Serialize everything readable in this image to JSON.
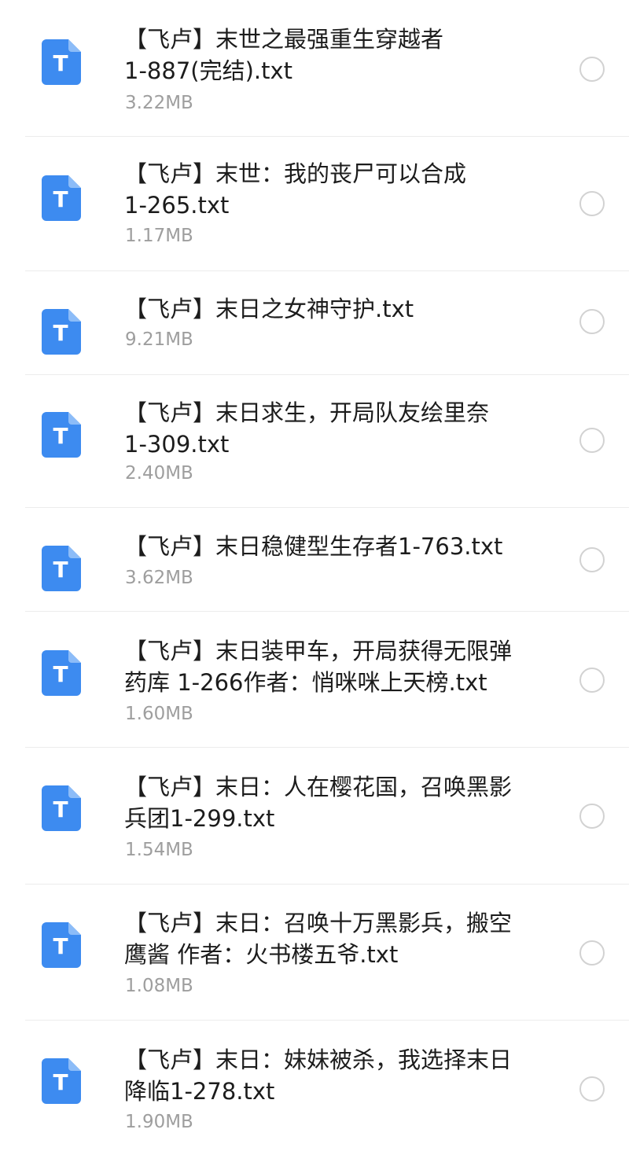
{
  "icon": {
    "name": "text-file-icon",
    "glyph": "T",
    "color": "#3d8bf0"
  },
  "files": [
    {
      "name_lines": [
        "【飞卢】末世之最强重生穿越者",
        "1-887(完结).txt"
      ],
      "size": "3.22MB"
    },
    {
      "name_lines": [
        "【飞卢】末世：我的丧尸可以合成",
        "1-265.txt"
      ],
      "size": "1.17MB"
    },
    {
      "name_lines": [
        "【飞卢】末日之女神守护.txt"
      ],
      "size": "9.21MB"
    },
    {
      "name_lines": [
        "【飞卢】末日求生，开局队友绘里奈",
        "1-309.txt"
      ],
      "size": "2.40MB"
    },
    {
      "name_lines": [
        "【飞卢】末日稳健型生存者1-763.txt"
      ],
      "size": "3.62MB"
    },
    {
      "name_lines": [
        "【飞卢】末日装甲车，开局获得无限弹",
        "药库 1-266作者：悄咪咪上天榜.txt"
      ],
      "size": "1.60MB"
    },
    {
      "name_lines": [
        "【飞卢】末日：人在樱花国，召唤黑影",
        "兵团1-299.txt"
      ],
      "size": "1.54MB"
    },
    {
      "name_lines": [
        "【飞卢】末日：召唤十万黑影兵，搬空",
        "鹰酱 作者：火书楼五爷.txt"
      ],
      "size": "1.08MB"
    },
    {
      "name_lines": [
        "【飞卢】末日：妹妹被杀，我选择末日",
        "降临1-278.txt"
      ],
      "size": "1.90MB"
    }
  ]
}
